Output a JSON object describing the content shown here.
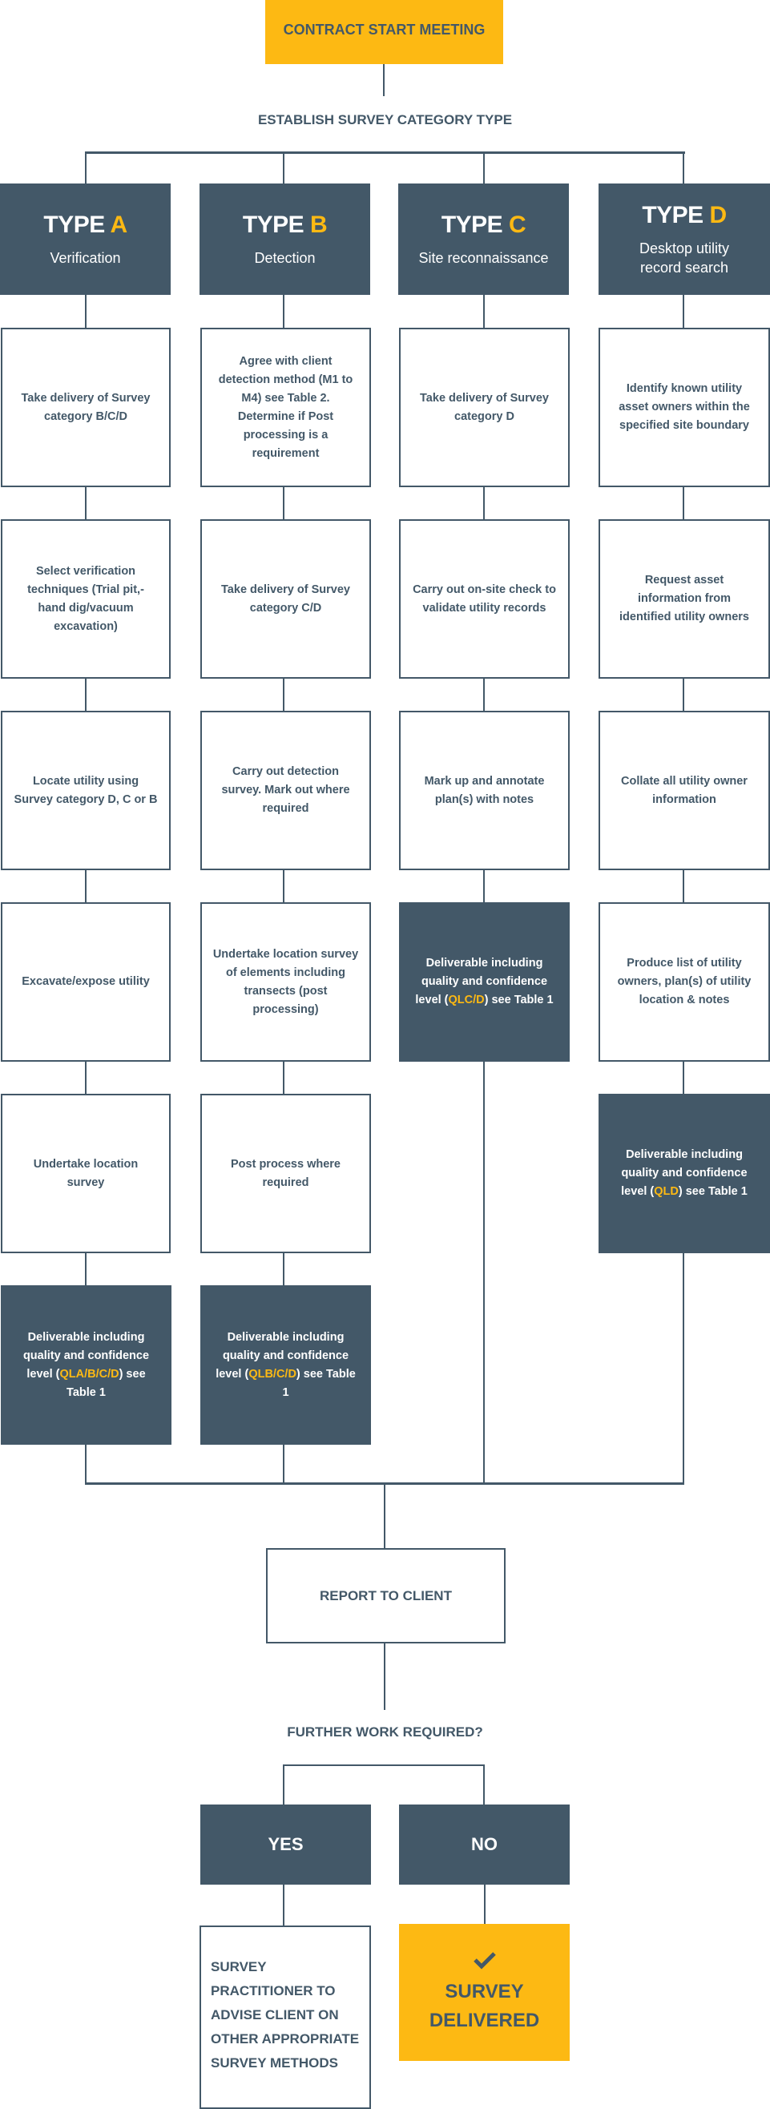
{
  "colors": {
    "accent": "#FDB913",
    "primary": "#435868",
    "background": "#ffffff"
  },
  "start": {
    "label": "CONTRACT START MEETING"
  },
  "establish": {
    "label": "ESTABLISH SURVEY CATEGORY TYPE"
  },
  "types": [
    {
      "prefix": "TYPE ",
      "letter": "A",
      "subtitle": "Verification"
    },
    {
      "prefix": "TYPE ",
      "letter": "B",
      "subtitle": "Detection"
    },
    {
      "prefix": "TYPE ",
      "letter": "C",
      "subtitle": "Site reconnaissance"
    },
    {
      "prefix": "TYPE ",
      "letter": "D",
      "subtitle": "Desktop utility record search"
    }
  ],
  "columns": {
    "a": {
      "steps": [
        "Take delivery of Survey category B/C/D",
        "Select verification techniques (Trial pit,- hand dig/vacuum excavation)",
        "Locate utility using Survey category D, C or B",
        "Excavate/expose utility",
        "Undertake location survey"
      ],
      "deliverable": {
        "before": "Deliverable including quality and confidence level (",
        "code": "QLA/B/C/D",
        "after": ") see Table 1"
      }
    },
    "b": {
      "steps": [
        "Agree with client detection method (M1 to M4) see Table 2. Determine if  Post processing is a requirement",
        "Take delivery of Survey category C/D",
        "Carry out detection survey. Mark out where required",
        "Undertake location survey of elements including transects (post processing)",
        "Post process where required"
      ],
      "deliverable": {
        "before": "Deliverable including quality and confidence level (",
        "code": "QLB/C/D",
        "after": ") see Table 1"
      }
    },
    "c": {
      "steps": [
        "Take delivery of Survey category D",
        "Carry out on-site check to validate utility records",
        "Mark up and annotate plan(s) with notes"
      ],
      "deliverable": {
        "before": "Deliverable including quality and confidence level (",
        "code": "QLC/D",
        "after": ") see Table 1"
      }
    },
    "d": {
      "steps": [
        "Identify known utility asset owners within the specified site boundary",
        "Request asset information from identified utility owners",
        "Collate all utility owner information",
        "Produce list of utility owners, plan(s) of utility location & notes"
      ],
      "deliverable": {
        "before": "Deliverable including quality and confidence level (",
        "code": "QLD",
        "after": ") see Table 1"
      }
    }
  },
  "report": {
    "label": "REPORT TO CLIENT"
  },
  "further": {
    "label": "FURTHER WORK REQUIRED?"
  },
  "yes": {
    "label": "YES",
    "outcome": "SURVEY PRACTITIONER TO ADVISE CLIENT ON OTHER APPROPRIATE SURVEY METHODS"
  },
  "no": {
    "label": "NO",
    "outcome": "SURVEY DELIVERED",
    "icon": "check-icon"
  }
}
